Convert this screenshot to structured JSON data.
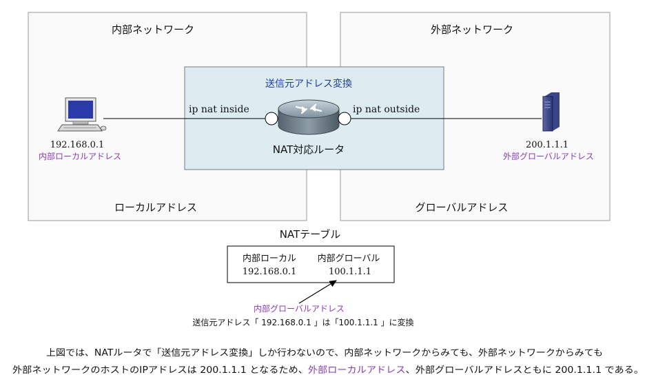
{
  "zones": {
    "internal_title": "内部ネットワーク",
    "external_title": "外部ネットワーク",
    "internal_bottom": "ローカルアドレス",
    "external_bottom": "グローバルアドレス"
  },
  "nat_box": {
    "title": "送信元アドレス変換",
    "inside_label": "ip nat inside",
    "outside_label": "ip nat outside",
    "router_label": "NAT対応ルータ"
  },
  "pc": {
    "ip": "192.168.0.1",
    "role": "内部ローカルアドレス"
  },
  "server": {
    "ip": "200.1.1.1",
    "role": "外部グローバルアドレス"
  },
  "nat_table": {
    "title": "NATテーブル",
    "headers": [
      "内部ローカル",
      "内部グローバル"
    ],
    "row": [
      "192.168.0.1",
      "100.1.1.1"
    ]
  },
  "annotation": {
    "label": "内部グローバルアドレス",
    "text": "送信元アドレス「 192.168.0.1 」は「100.1.1.1 」に変換"
  },
  "footer": {
    "line1": "上図では、NATルータで「送信元アドレス変換」しか行わないので、内部ネットワークからみても、外部ネットワークからみても",
    "line2_a": "外部ネットワークのホストのIPアドレスは 200.1.1.1 となるため、",
    "line2_b": "外部ローカルアドレス",
    "line2_c": "、外部グローバルアドレスともに 200.1.1.1 である。"
  },
  "colors": {
    "accent_purple": "#8a3ab8",
    "title_blue": "#1f3fa0",
    "nat_fill": "#dcecf1",
    "zone_stroke": "#9a9a9a"
  }
}
